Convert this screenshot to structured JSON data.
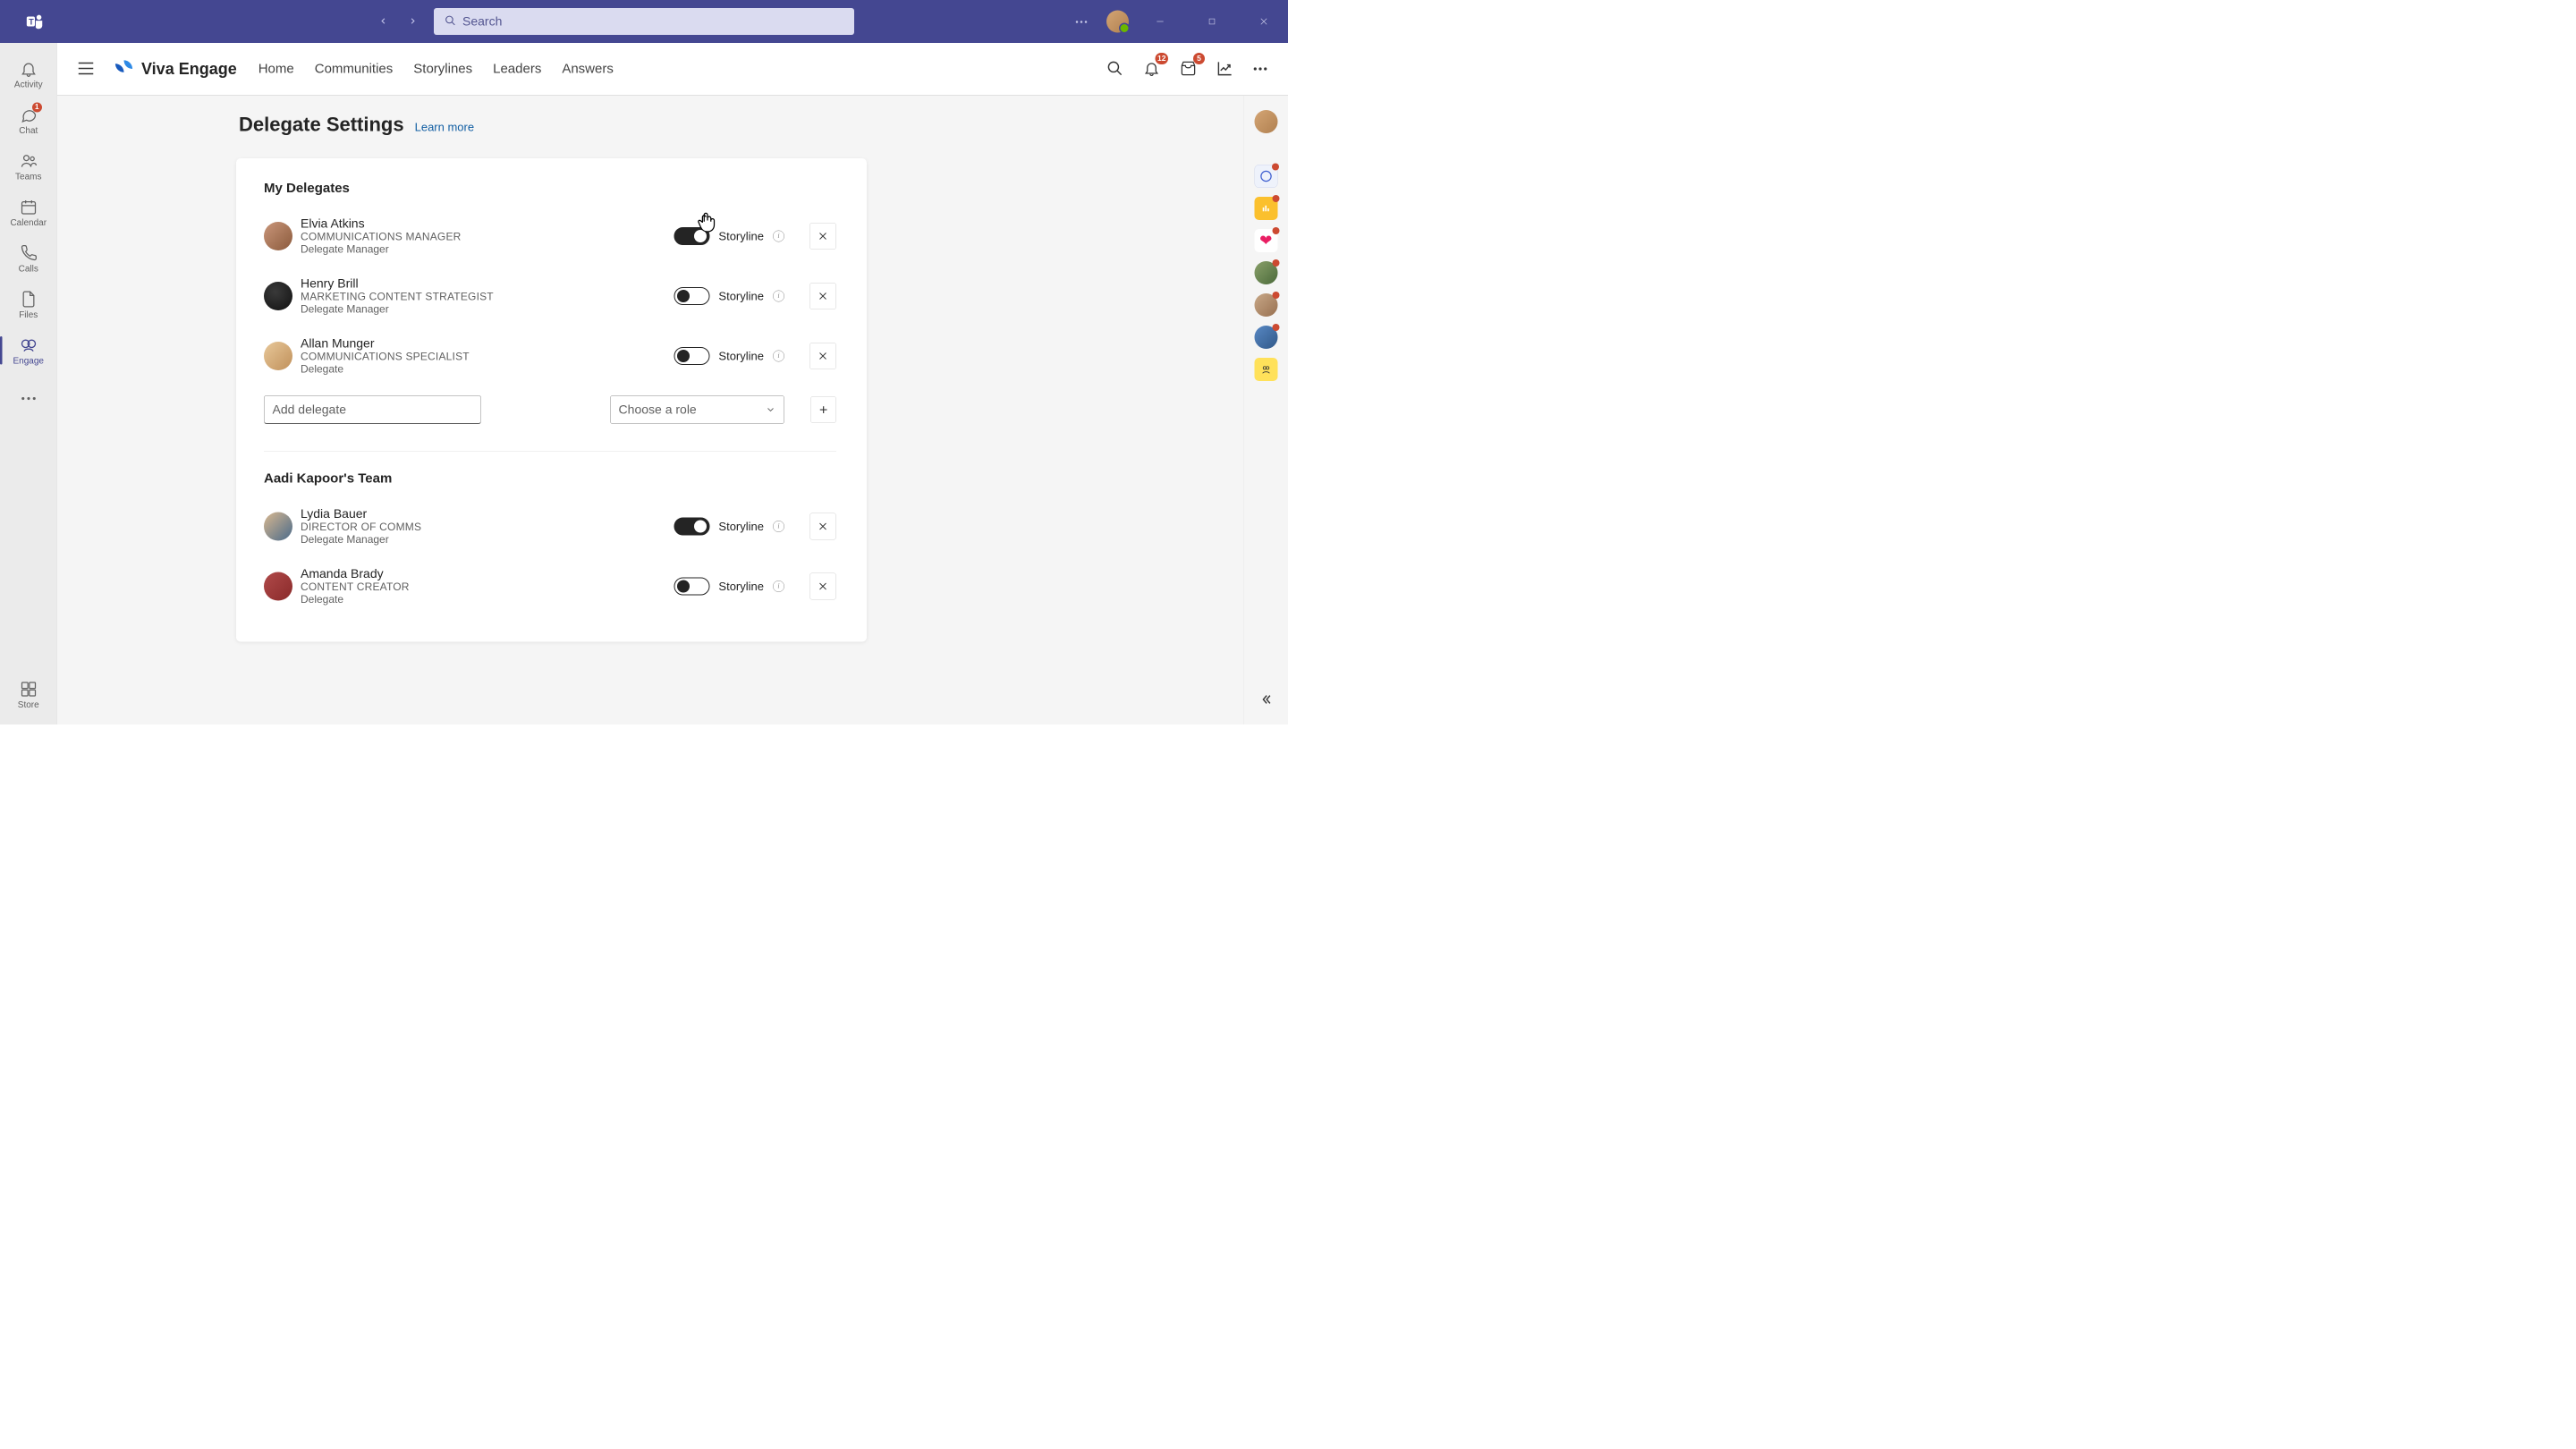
{
  "titlebar": {
    "search_placeholder": "Search"
  },
  "rail_left": {
    "activity": "Activity",
    "chat": "Chat",
    "chat_badge": "1",
    "teams": "Teams",
    "calendar": "Calendar",
    "calls": "Calls",
    "files": "Files",
    "engage": "Engage",
    "store": "Store"
  },
  "app_header": {
    "title": "Viva Engage",
    "nav": {
      "home": "Home",
      "communities": "Communities",
      "storylines": "Storylines",
      "leaders": "Leaders",
      "answers": "Answers"
    },
    "notification_badge": "12",
    "inbox_badge": "5"
  },
  "page": {
    "title": "Delegate Settings",
    "learn_more": "Learn more"
  },
  "sections": {
    "my_delegates": "My Delegates",
    "team_title": "Aadi Kapoor's Team"
  },
  "delegates": {
    "d1": {
      "name": "Elvia Atkins",
      "title": "COMMUNICATIONS MANAGER",
      "role": "Delegate Manager"
    },
    "d2": {
      "name": "Henry Brill",
      "title": "MARKETING CONTENT STRATEGIST",
      "role": "Delegate Manager"
    },
    "d3": {
      "name": "Allan Munger",
      "title": "COMMUNICATIONS SPECIALIST",
      "role": "Delegate"
    },
    "d4": {
      "name": "Lydia Bauer",
      "title": "DIRECTOR OF COMMS",
      "role": "Delegate Manager"
    },
    "d5": {
      "name": "Amanda Brady",
      "title": "CONTENT CREATOR",
      "role": "Delegate"
    }
  },
  "row_controls": {
    "storyline": "Storyline"
  },
  "add_row": {
    "input_placeholder": "Add delegate",
    "role_placeholder": "Choose a role"
  }
}
